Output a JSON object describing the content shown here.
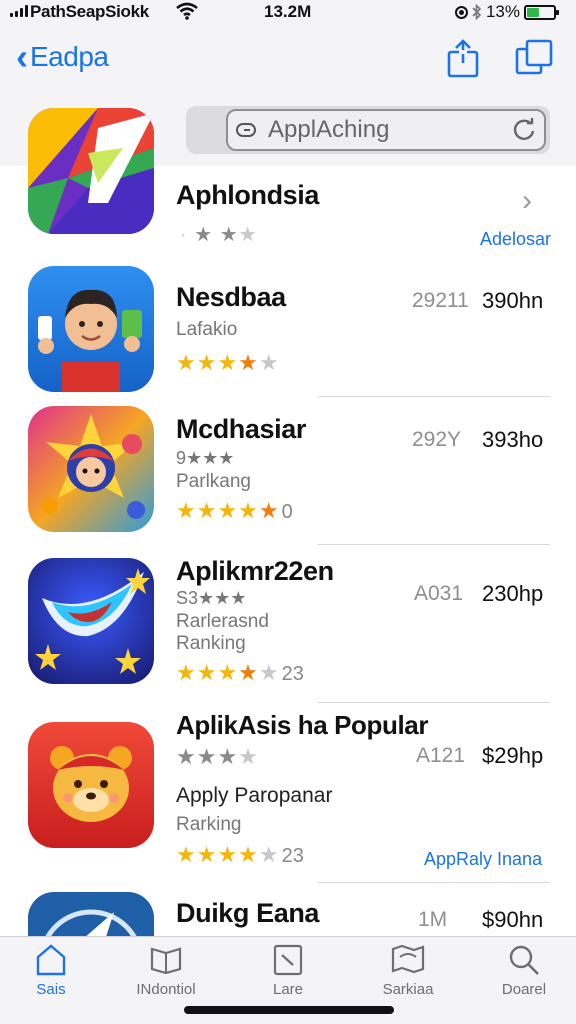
{
  "status_bar": {
    "carrier": "PathSeapSiokk",
    "time": "13.2M",
    "battery": "13%"
  },
  "nav": {
    "back_label": "Eadpa",
    "share_icon": "share-icon",
    "tabs_icon": "tabs-icon"
  },
  "search": {
    "value": "ApplAching"
  },
  "header_app": {
    "name": "Aphlondsia",
    "rating": 2,
    "link": "Adelosar"
  },
  "apps": [
    {
      "name": "Nesdbaa",
      "subtitle": "Lafakio",
      "rating": 3.5,
      "rank": "29211",
      "price": "390hn"
    },
    {
      "name": "Mcdhasiar",
      "subtitle_stars": "9★★★",
      "subtitle": "Parlkang",
      "rating": 4.5,
      "rating_count": "0",
      "rank": "292Y",
      "price": "393ho"
    },
    {
      "name": "Aplikmr22en",
      "subtitle_stars": "S3★★★",
      "subtitle": "Rarlerasnd",
      "subtitle2": "Ranking",
      "rating": 3.5,
      "rating_count": "23",
      "rank": "A031",
      "price": "230hp"
    },
    {
      "name": "AplikAsis ha Popular",
      "grey_rating": 3,
      "subtitle": "Apply Paropanar",
      "subtitle2": "Rarking",
      "rating": 4,
      "rating_count": "23",
      "rank": "A121",
      "price": "$29hp",
      "link": "AppRaly Inana"
    },
    {
      "name": "Duikg Eana",
      "rank": "1M",
      "price": "$90hn"
    }
  ],
  "tabbar": {
    "tabs": [
      {
        "label": "Sais",
        "icon": "home-icon"
      },
      {
        "label": "INdontiol",
        "icon": "book-icon"
      },
      {
        "label": "Lare",
        "icon": "clock-icon"
      },
      {
        "label": "Sarkiaa",
        "icon": "map-icon"
      },
      {
        "label": "Doarel",
        "icon": "search-icon"
      }
    ]
  },
  "colors": {
    "accent": "#1a73e8",
    "star": "#f5b60c",
    "battery": "#2fb84a"
  }
}
